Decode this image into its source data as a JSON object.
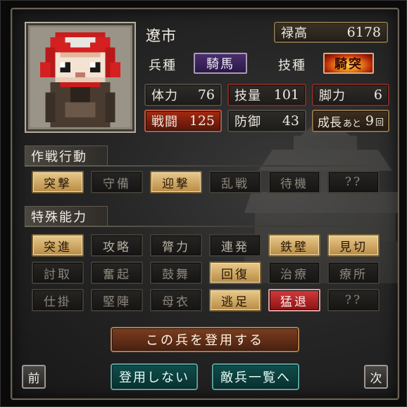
{
  "unit": {
    "name": "遼市",
    "portrait_icon": "pixel-warrior-portrait"
  },
  "stipend": {
    "label": "禄高",
    "value": "6178"
  },
  "troop_type": {
    "label": "兵種",
    "value": "騎馬"
  },
  "skill_type": {
    "label": "技種",
    "value": "騎突"
  },
  "stats": {
    "hp": {
      "label": "体力",
      "value": "76"
    },
    "skill": {
      "label": "技量",
      "value": "101"
    },
    "legs": {
      "label": "脚力",
      "value": "6"
    },
    "combat": {
      "label": "戦闘",
      "value": "125"
    },
    "defense": {
      "label": "防御",
      "value": "43"
    },
    "growth": {
      "label": "成長",
      "suffix": "あと",
      "value": "9",
      "unit": "回"
    }
  },
  "sections": {
    "tactics_title": "作戦行動",
    "abilities_title": "特殊能力"
  },
  "tactics": [
    {
      "label": "突撃",
      "state": "on"
    },
    {
      "label": "守備",
      "state": "off"
    },
    {
      "label": "迎撃",
      "state": "on"
    },
    {
      "label": "乱戦",
      "state": "off"
    },
    {
      "label": "待機",
      "state": "off"
    },
    {
      "label": "??",
      "state": "off"
    }
  ],
  "abilities": [
    [
      {
        "label": "突進",
        "state": "on"
      },
      {
        "label": "攻略",
        "state": "mid"
      },
      {
        "label": "膂力",
        "state": "mid"
      },
      {
        "label": "連発",
        "state": "mid"
      },
      {
        "label": "鉄壁",
        "state": "on"
      },
      {
        "label": "見切",
        "state": "on"
      }
    ],
    [
      {
        "label": "討取",
        "state": "off"
      },
      {
        "label": "奮起",
        "state": "off"
      },
      {
        "label": "鼓舞",
        "state": "off"
      },
      {
        "label": "回復",
        "state": "on"
      },
      {
        "label": "治療",
        "state": "off"
      },
      {
        "label": "療所",
        "state": "off"
      }
    ],
    [
      {
        "label": "仕掛",
        "state": "off"
      },
      {
        "label": "堅陣",
        "state": "off"
      },
      {
        "label": "母衣",
        "state": "off"
      },
      {
        "label": "逃足",
        "state": "on"
      },
      {
        "label": "猛退",
        "state": "red"
      },
      {
        "label": "??",
        "state": "off"
      }
    ]
  ],
  "buttons": {
    "recruit": "この兵を登用する",
    "not_recruit": "登用しない",
    "enemy_list": "敵兵一覧へ",
    "prev": "前",
    "next": "次"
  },
  "colors": {
    "active_chip": "#d9b370",
    "red_chip": "#b52222",
    "teal_button": "#0f4e4c",
    "recruit_button": "#6a3319"
  }
}
